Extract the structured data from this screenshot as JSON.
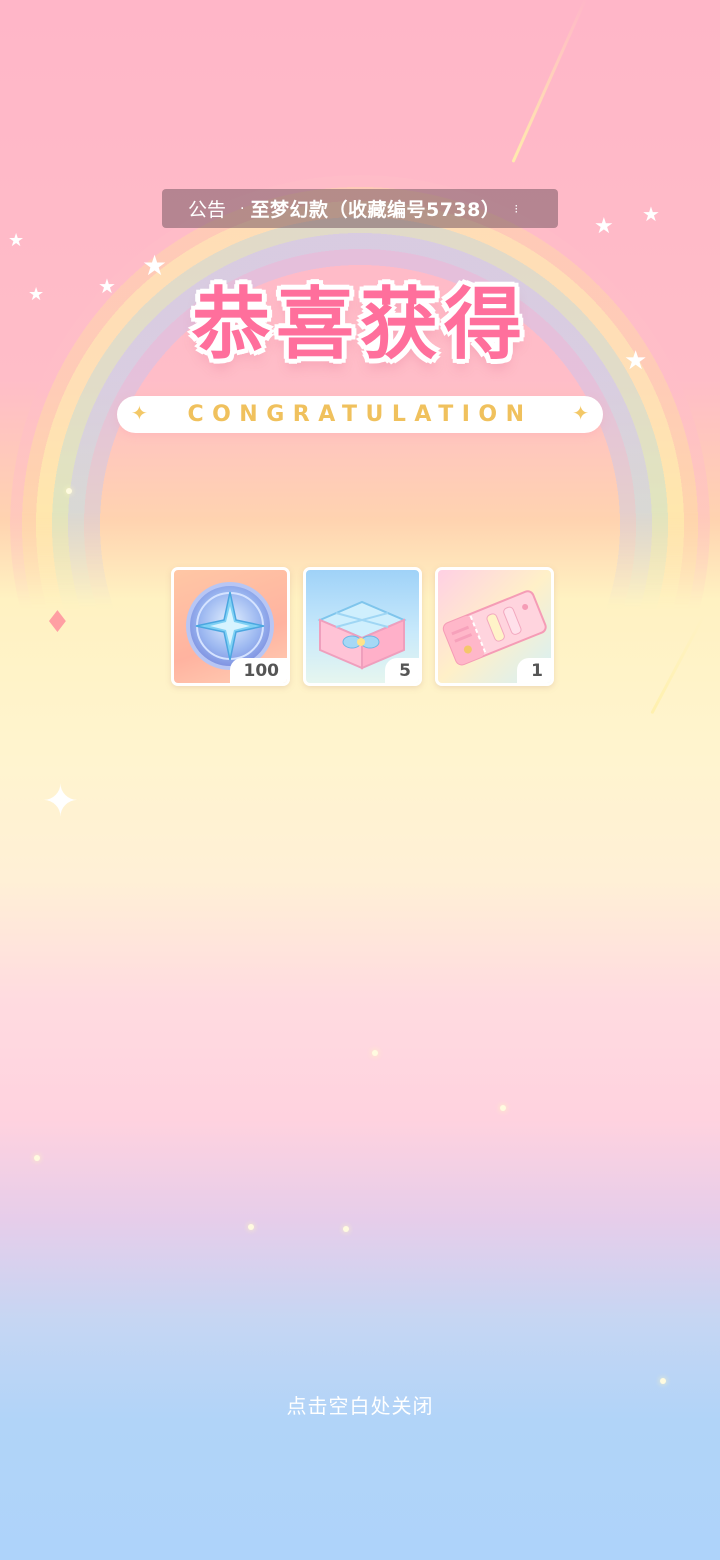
{
  "notice": {
    "label": "公告",
    "bullet": "·",
    "text": "至梦幻款（收藏编号5738）",
    "more": "⁝"
  },
  "title": "恭喜获得",
  "subtitle": "CONGRATULATION",
  "rewards": [
    {
      "icon": "compass-coin-icon",
      "quantity": "100"
    },
    {
      "icon": "gift-box-icon",
      "quantity": "5"
    },
    {
      "icon": "ticket-icon",
      "quantity": "1"
    }
  ],
  "close_hint": "点击空白处关闭",
  "colors": {
    "title_pink": "#ff6f9c",
    "subtitle_gold": "#f0c15d",
    "notice_bg": "rgba(120,90,100,0.55)"
  }
}
